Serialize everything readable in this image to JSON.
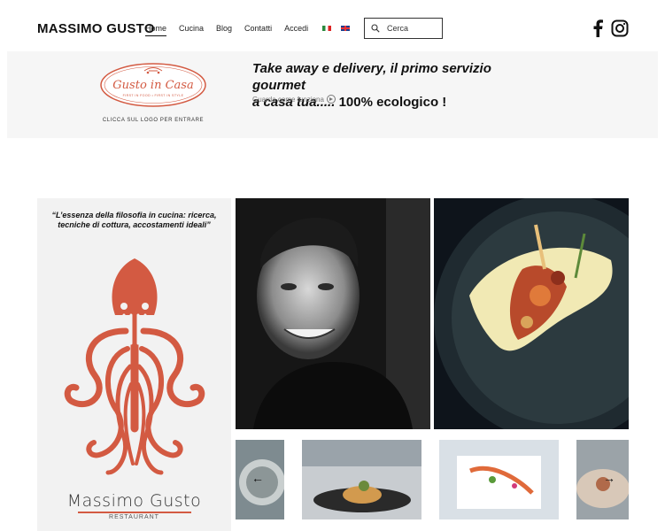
{
  "header": {
    "brand": "MASSIMO GUSTO",
    "nav": [
      "Home",
      "Cucina",
      "Blog",
      "Contatti",
      "Accedi"
    ],
    "search_placeholder": "Cerca"
  },
  "banner": {
    "logo_title": "Gusto in Casa",
    "logo_tagline": "FIRST IN FOOD • FIRST IN STYLE",
    "logo_caption": "CLICCA SUL LOGO PER ENTRARE",
    "promo_line1": "Take away e delivery, il primo servizio gourmet",
    "promo_line2_italic": "a casa tua..... ",
    "promo_line2_plain": "100% ecologico !",
    "watch_label": "Guarda come funziona"
  },
  "poster": {
    "quote": "“L’essenza della filosofia in cucina: ricerca, tecniche di cottura, accostamenti ideali”",
    "name": "Massimo Gusto",
    "sub": "RESTAURANT"
  },
  "colors": {
    "accent": "#d35a42",
    "banner_bg": "#f6f6f6",
    "poster_bg": "#f2f2f2",
    "text": "#111111"
  },
  "icons": [
    "search-icon",
    "facebook-icon",
    "instagram-icon",
    "play-icon",
    "flag-it-icon",
    "flag-uk-icon",
    "chevron-left-icon",
    "chevron-right-icon"
  ]
}
